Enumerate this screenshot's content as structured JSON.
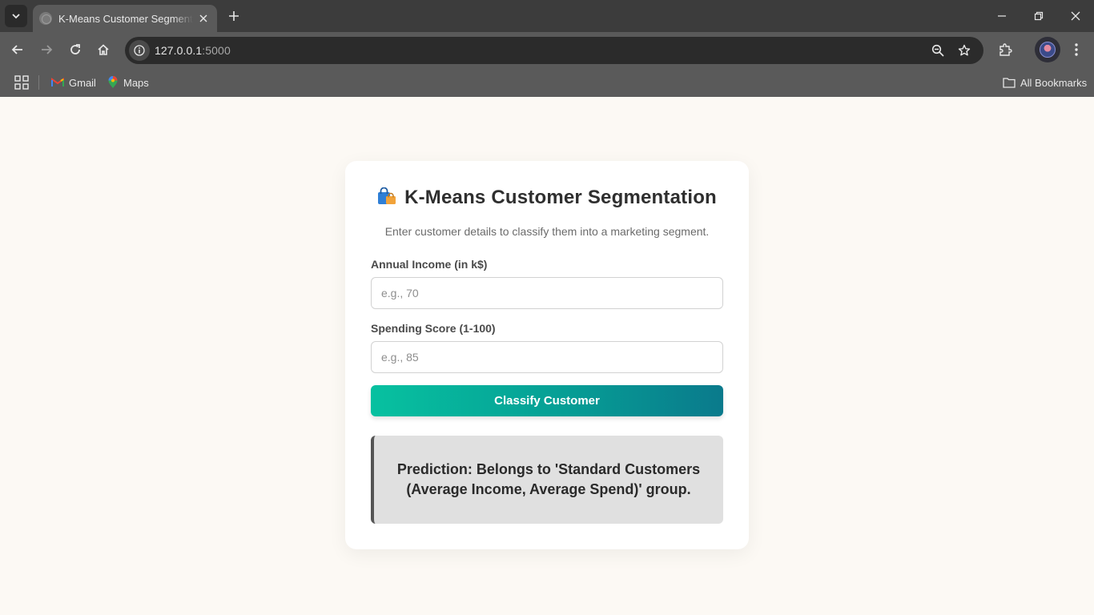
{
  "browser": {
    "tab_title": "K-Means Customer Segmentation",
    "url_host": "127.0.0.1",
    "url_port": ":5000",
    "bookmarks": [
      {
        "label": "Gmail",
        "icon": "gmail-icon"
      },
      {
        "label": "Maps",
        "icon": "maps-icon"
      }
    ],
    "all_bookmarks_label": "All Bookmarks"
  },
  "app": {
    "title": "K-Means Customer Segmentation",
    "title_icon": "shopping-bags-icon",
    "subtitle": "Enter customer details to classify them into a marketing segment.",
    "income": {
      "label": "Annual Income (in k$)",
      "placeholder": "e.g., 70",
      "value": ""
    },
    "spending": {
      "label": "Spending Score (1-100)",
      "placeholder": "e.g., 85",
      "value": ""
    },
    "submit_label": "Classify Customer",
    "result_text": "Prediction: Belongs to 'Standard Customers (Average Income, Average Spend)' group."
  },
  "colors": {
    "page_background": "#fcf9f4",
    "button_gradient_start": "#07c1a0",
    "button_gradient_end": "#0a7a8c",
    "result_background": "#e0e0e0",
    "result_border": "#555555"
  }
}
